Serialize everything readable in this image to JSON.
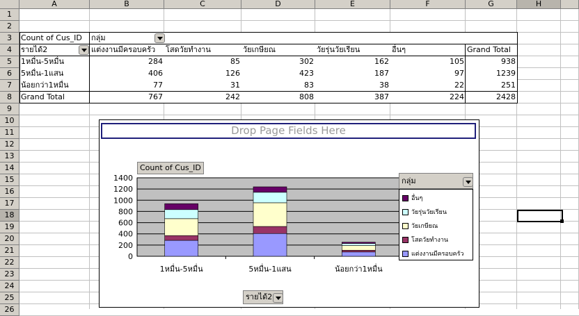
{
  "columns": [
    "A",
    "B",
    "C",
    "D",
    "E",
    "F",
    "G",
    "H"
  ],
  "rows": [
    "1",
    "2",
    "3",
    "4",
    "5",
    "6",
    "7",
    "8",
    "9",
    "10",
    "11",
    "12",
    "13",
    "14",
    "15",
    "16",
    "17",
    "18",
    "19",
    "20",
    "21",
    "22",
    "23",
    "24",
    "25",
    "26"
  ],
  "pivot": {
    "data_field": "Count of Cus_ID",
    "column_field": "กลุ่ม",
    "row_field": "รายได้2",
    "col_headers": [
      "แต่งงานมีครอบครัว",
      "โสดวัยทำงาน",
      "วัยเกษียณ",
      "วัยรุ่นวัยเรียน",
      "อื่นๆ",
      "Grand Total"
    ],
    "rows": [
      {
        "label": "1หมื่น-5หมื่น",
        "values": [
          "284",
          "85",
          "302",
          "162",
          "105",
          "938"
        ]
      },
      {
        "label": "5หมื่น-1แสน",
        "values": [
          "406",
          "126",
          "423",
          "187",
          "97",
          "1239"
        ]
      },
      {
        "label": "น้อยกว่า1หมื่น",
        "values": [
          "77",
          "31",
          "83",
          "38",
          "22",
          "251"
        ]
      },
      {
        "label": "Grand Total",
        "values": [
          "767",
          "242",
          "808",
          "387",
          "224",
          "2428"
        ]
      }
    ]
  },
  "chart": {
    "drop_zone": "Drop Page Fields Here",
    "data_button": "Count of Cus_ID",
    "category_button": "รายได้2",
    "legend_title": "กลุ่ม"
  },
  "chart_data": {
    "type": "bar",
    "stacked": true,
    "categories": [
      "1หมื่น-5หมื่น",
      "5หมื่น-1แสน",
      "น้อยกว่า1หมื่น"
    ],
    "series": [
      {
        "name": "แต่งงานมีครอบครัว",
        "values": [
          284,
          406,
          77
        ],
        "color": "#9999ff"
      },
      {
        "name": "โสดวัยทำงาน",
        "values": [
          85,
          126,
          31
        ],
        "color": "#993366"
      },
      {
        "name": "วัยเกษียณ",
        "values": [
          302,
          423,
          83
        ],
        "color": "#ffffcc"
      },
      {
        "name": "วัยรุ่นวัยเรียน",
        "values": [
          162,
          187,
          38
        ],
        "color": "#ccffff"
      },
      {
        "name": "อื่นๆ",
        "values": [
          105,
          97,
          22
        ],
        "color": "#660066"
      }
    ],
    "legend_order": [
      "อื่นๆ",
      "วัยรุ่นวัยเรียน",
      "วัยเกษียณ",
      "โสดวัยทำงาน",
      "แต่งงานมีครอบครัว"
    ],
    "yticks": [
      "0",
      "200",
      "400",
      "600",
      "800",
      "1000",
      "1200",
      "1400"
    ],
    "ylim": [
      0,
      1400
    ],
    "plot_bg": "#c0c0c0",
    "grid": true,
    "legend_position": "right"
  }
}
